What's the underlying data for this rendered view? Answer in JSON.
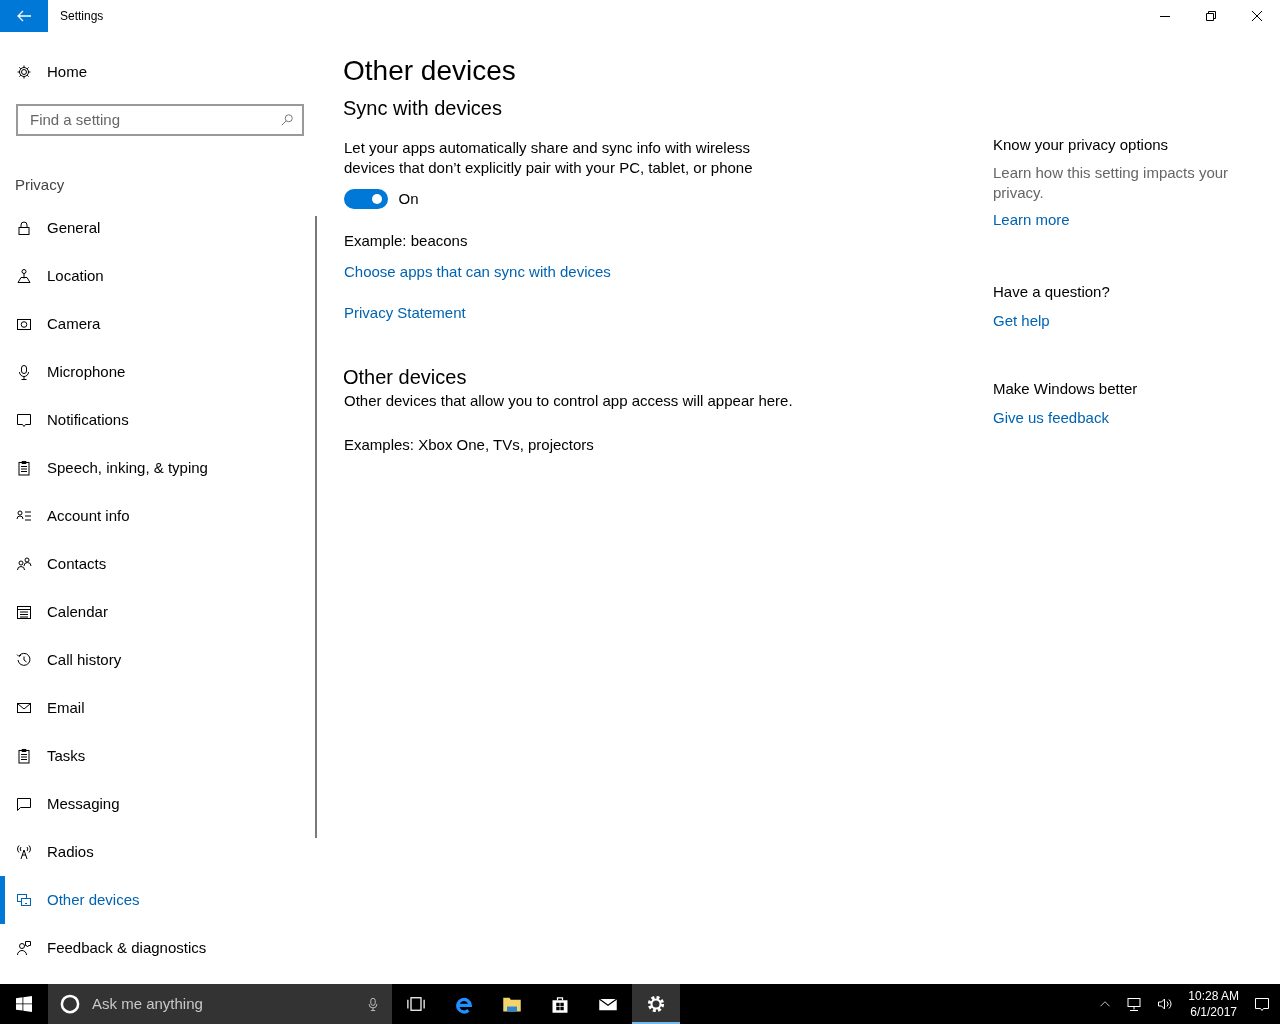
{
  "window": {
    "title": "Settings"
  },
  "sidebar": {
    "home": "Home",
    "search": {
      "placeholder": "Find a setting"
    },
    "section": "Privacy",
    "items": [
      {
        "label": "General",
        "selected": false
      },
      {
        "label": "Location",
        "selected": false
      },
      {
        "label": "Camera",
        "selected": false
      },
      {
        "label": "Microphone",
        "selected": false
      },
      {
        "label": "Notifications",
        "selected": false
      },
      {
        "label": "Speech, inking, & typing",
        "selected": false
      },
      {
        "label": "Account info",
        "selected": false
      },
      {
        "label": "Contacts",
        "selected": false
      },
      {
        "label": "Calendar",
        "selected": false
      },
      {
        "label": "Call history",
        "selected": false
      },
      {
        "label": "Email",
        "selected": false
      },
      {
        "label": "Tasks",
        "selected": false
      },
      {
        "label": "Messaging",
        "selected": false
      },
      {
        "label": "Radios",
        "selected": false
      },
      {
        "label": "Other devices",
        "selected": true
      },
      {
        "label": "Feedback & diagnostics",
        "selected": false
      }
    ]
  },
  "content": {
    "title": "Other devices",
    "sync": {
      "heading": "Sync with devices",
      "description": "Let your apps automatically share and sync info with wireless devices that don’t explicitly pair with your PC, tablet, or phone",
      "toggle": {
        "on": true,
        "label": "On"
      },
      "example": "Example: beacons",
      "links": [
        "Choose apps that can sync with devices",
        "Privacy Statement"
      ]
    },
    "other": {
      "heading": "Other devices",
      "description": "Other devices that allow you to control app access will appear here.",
      "examples": "Examples: Xbox One, TVs, projectors"
    }
  },
  "aside": [
    {
      "heading": "Know your privacy options",
      "text": "Learn how this setting impacts your privacy.",
      "link": "Learn more"
    },
    {
      "heading": "Have a question?",
      "link": "Get help"
    },
    {
      "heading": "Make Windows better",
      "link": "Give us feedback"
    }
  ],
  "taskbar": {
    "search_placeholder": "Ask me anything",
    "apps": [
      {
        "selected": false
      },
      {
        "selected": false
      },
      {
        "selected": false
      },
      {
        "selected": false
      },
      {
        "selected": false
      },
      {
        "selected": true
      }
    ],
    "time": "10:28 AM",
    "date": "6/1/2017"
  }
}
